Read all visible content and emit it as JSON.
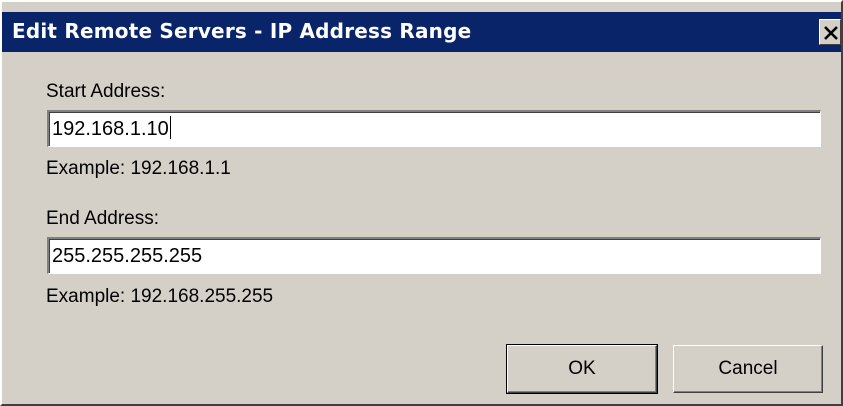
{
  "window": {
    "title": "Edit Remote Servers - IP Address Range",
    "close_icon": "close-icon"
  },
  "form": {
    "start_label": "Start Address:",
    "start_value": "192.168.1.10",
    "start_example": "Example: 192.168.1.1",
    "end_label": "End Address:",
    "end_value": "255.255.255.255",
    "end_example": "Example: 192.168.255.255"
  },
  "buttons": {
    "ok_label": "OK",
    "cancel_label": "Cancel"
  },
  "colors": {
    "title_bar": "#0a246a",
    "dialog_face": "#d4d0c8"
  }
}
